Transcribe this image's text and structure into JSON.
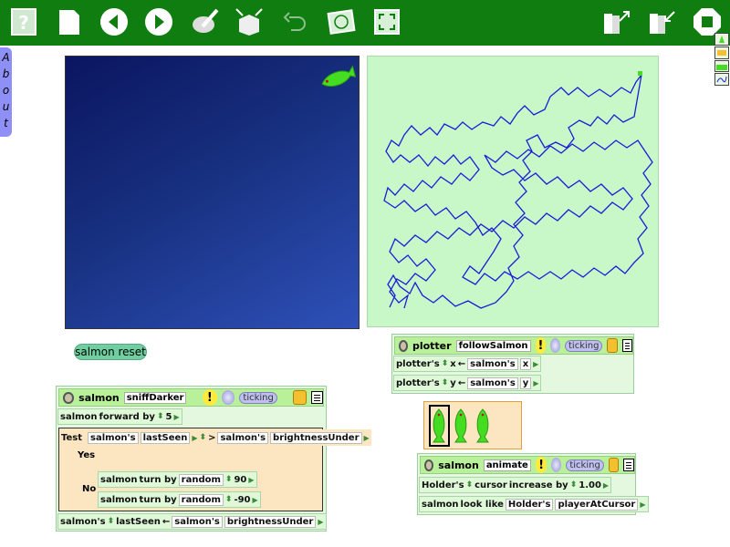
{
  "toolbar": {
    "buttons": [
      "help-icon",
      "new-page-icon",
      "previous-icon",
      "next-icon",
      "paint-icon",
      "supplies-icon",
      "undo-icon",
      "world-icon",
      "fullscreen-icon",
      "import-icon",
      "export-icon",
      "stop-icon"
    ]
  },
  "about_tab": {
    "label": "About"
  },
  "reset_button": {
    "label": "salmon reset"
  },
  "plotter_script": {
    "object": "plotter",
    "name": "followSalmon",
    "bang": "!",
    "status": "ticking",
    "rows": [
      {
        "target": "plotter's",
        "slot": "x",
        "arrow": "←",
        "source": "salmon's",
        "field": "x"
      },
      {
        "target": "plotter's",
        "slot": "y",
        "arrow": "←",
        "source": "salmon's",
        "field": "y"
      }
    ]
  },
  "sniff_script": {
    "object": "salmon",
    "name": "sniffDarker",
    "bang": "!",
    "status": "ticking",
    "forward": {
      "object": "salmon",
      "command": "forward by",
      "value": "5"
    },
    "test": {
      "label": "Test",
      "lhs_obj": "salmon's",
      "lhs": "lastSeen",
      "op": ">",
      "rhs_obj": "salmon's",
      "rhs": "brightnessUnder"
    },
    "yes_label": "Yes",
    "no_label": "No",
    "no_rows": [
      {
        "object": "salmon",
        "command": "turn by",
        "func": "random",
        "value": "90"
      },
      {
        "object": "salmon",
        "command": "turn by",
        "func": "random",
        "value": "-90"
      }
    ],
    "final": {
      "target": "salmon's",
      "slot": "lastSeen",
      "arrow": "←",
      "source": "salmon's",
      "field": "brightnessUnder"
    }
  },
  "animate_script": {
    "object": "salmon",
    "name": "animate",
    "bang": "!",
    "status": "ticking",
    "row1": {
      "target": "Holder's",
      "slot": "cursor",
      "op": "increase by",
      "value": "1.00"
    },
    "row2": {
      "object": "salmon",
      "command": "look like",
      "source": "Holder's",
      "field": "playerAtCursor"
    }
  },
  "colors": {
    "toolbar": "#0f7d0f",
    "plot_bg": "#c8f8c8",
    "pen": "#1b1bd8",
    "salmon": "#44dd22"
  }
}
